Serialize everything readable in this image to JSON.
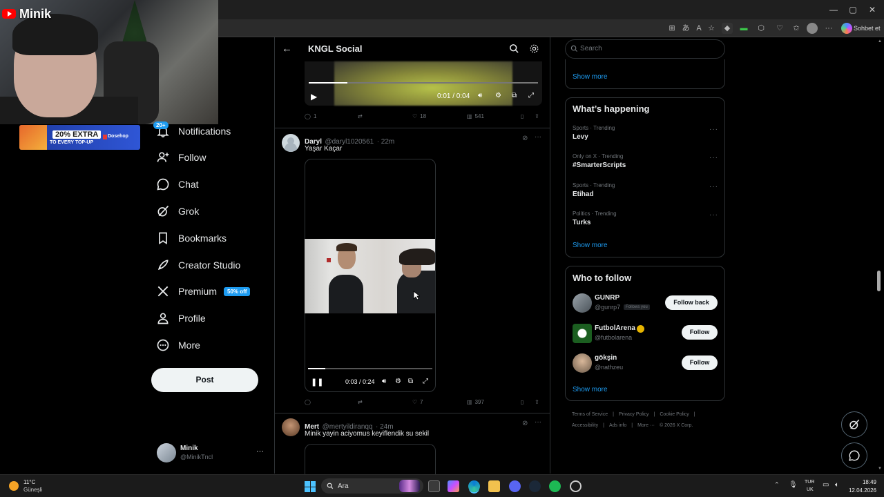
{
  "overlay": {
    "channel_name": "Minik",
    "promo_big": "20% EXTRA",
    "promo_small": "TO EVERY TOP-UP",
    "promo_brand": "Dosehop",
    "notif_badge": "20+"
  },
  "nav": {
    "items": [
      {
        "label": "Notifications",
        "icon": "bell-icon"
      },
      {
        "label": "Follow",
        "icon": "person-add-icon"
      },
      {
        "label": "Chat",
        "icon": "chat-bubble-icon"
      },
      {
        "label": "Grok",
        "icon": "grok-icon"
      },
      {
        "label": "Bookmarks",
        "icon": "bookmark-icon"
      },
      {
        "label": "Creator Studio",
        "icon": "rocket-icon"
      },
      {
        "label": "Premium",
        "icon": "x-logo-icon"
      },
      {
        "label": "Profile",
        "icon": "person-icon"
      },
      {
        "label": "More",
        "icon": "more-circle-icon"
      }
    ],
    "premium_badge": "50% off",
    "post_label": "Post",
    "account": {
      "name": "Minik",
      "handle": "@MinikTncl"
    }
  },
  "header": {
    "title": "KNGL Social"
  },
  "feed": {
    "video1": {
      "time": "0:01 / 0:04",
      "progress": 0.17
    },
    "post1_actions": {
      "replies": "1",
      "likes": "18",
      "views": "541"
    },
    "post2": {
      "name": "Daryl",
      "handle": "@daryl1020561",
      "age": "· 22m",
      "text": "Yaşar Kaçar",
      "video_time": "0:03 / 0:24",
      "video_progress": 0.14,
      "likes": "7",
      "views": "397"
    },
    "post3": {
      "name": "Mert",
      "handle": "@mertyildiranqq",
      "age": "· 24m",
      "text": "Minik yayin aciyomus keyiflendik su sekil"
    }
  },
  "right": {
    "search_placeholder": "Search",
    "show_more_top": "Show more",
    "happening": {
      "title": "What’s happening",
      "trends": [
        {
          "meta": "Sports · Trending",
          "name": "Levy"
        },
        {
          "meta": "Only on X · Trending",
          "name": "#SmarterScripts"
        },
        {
          "meta": "Sports · Trending",
          "name": "Etihad"
        },
        {
          "meta": "Politics · Trending",
          "name": "Turks"
        }
      ],
      "show_more": "Show more"
    },
    "who_to_follow": {
      "title": "Who to follow",
      "users": [
        {
          "name": "GUNRP",
          "handle": "@gunrp7",
          "button": "Follow back",
          "follows_you": "Follows you"
        },
        {
          "name": "FutbolArena",
          "handle": "@futbolarena",
          "button": "Follow"
        },
        {
          "name": "gökşin",
          "handle": "@nathzeu",
          "button": "Follow"
        }
      ],
      "show_more": "Show more"
    },
    "footer": {
      "line1": [
        "Terms of Service",
        "|",
        "Privacy Policy",
        "|",
        "Cookie Policy",
        "|"
      ],
      "line2": [
        "Accessibility",
        "|",
        "Ads info",
        "|",
        "More ···",
        "© 2026 X Corp."
      ]
    }
  },
  "browser": {
    "copilot_label": "Sohbet et"
  },
  "taskbar": {
    "weather_temp": "11°C",
    "weather_desc": "Güneşli",
    "search_text": "Ara",
    "lang1": "TUR",
    "lang2": "UK",
    "time": "18:49",
    "date": "12.04.2026"
  },
  "colors": {
    "accent": "#1d9bf0",
    "background": "#000000",
    "border": "#2f3336",
    "muted": "#71767b"
  }
}
